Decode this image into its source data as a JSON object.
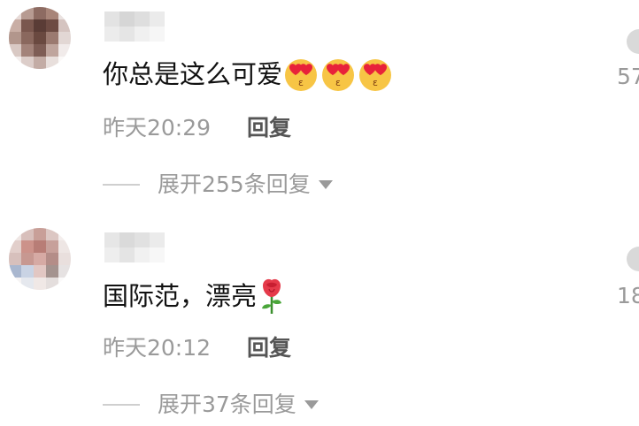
{
  "comments": [
    {
      "text": "你总是这么可爱",
      "emoji": "kissing-heart-eyes-face",
      "emoji_count": 3,
      "time": "昨天20:29",
      "reply_label": "回复",
      "expand_label": "展开255条回复",
      "like_count": "57"
    },
    {
      "text": "国际范，漂亮",
      "emoji": "rose",
      "emoji_count": 1,
      "time": "昨天20:12",
      "reply_label": "回复",
      "expand_label": "展开37条回复",
      "like_count": "18"
    }
  ],
  "colors": {
    "text": "#111111",
    "meta": "#9a9a9a",
    "reply": "#555555",
    "background": "#ffffff"
  }
}
